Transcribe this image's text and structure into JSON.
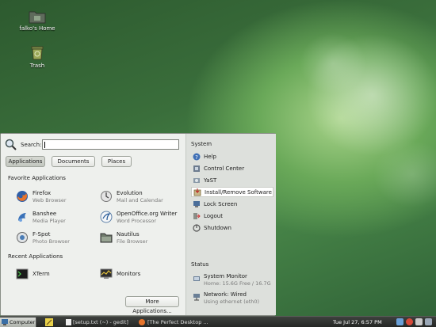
{
  "desktop": {
    "home_label": "falko's Home",
    "trash_label": "Trash"
  },
  "menu": {
    "search_label": "Search:",
    "search_value": "",
    "tabs": [
      {
        "label": "Applications",
        "active": true
      },
      {
        "label": "Documents",
        "active": false
      },
      {
        "label": "Places",
        "active": false
      }
    ],
    "favorites_title": "Favorite Applications",
    "favorites": [
      {
        "name": "Firefox",
        "desc": "Web Browser",
        "icon": "firefox-icon"
      },
      {
        "name": "Evolution",
        "desc": "Mail and Calendar",
        "icon": "evolution-icon"
      },
      {
        "name": "Banshee",
        "desc": "Media Player",
        "icon": "banshee-icon"
      },
      {
        "name": "OpenOffice.org Writer",
        "desc": "Word Processor",
        "icon": "writer-icon"
      },
      {
        "name": "F-Spot",
        "desc": "Photo Browser",
        "icon": "fspot-icon"
      },
      {
        "name": "Nautilus",
        "desc": "File Browser",
        "icon": "nautilus-icon"
      }
    ],
    "recent_title": "Recent Applications",
    "recent": [
      {
        "name": "XTerm",
        "icon": "xterm-icon"
      },
      {
        "name": "Monitors",
        "icon": "monitors-icon"
      }
    ],
    "more_label": "More Applications...",
    "system_title": "System",
    "system_items": [
      {
        "label": "Help",
        "icon": "help-icon"
      },
      {
        "label": "Control Center",
        "icon": "control-center-icon"
      },
      {
        "label": "YaST",
        "icon": "yast-icon"
      },
      {
        "label": "Install/Remove Software",
        "icon": "install-software-icon"
      },
      {
        "label": "Lock Screen",
        "icon": "lock-icon"
      },
      {
        "label": "Logout",
        "icon": "logout-icon"
      },
      {
        "label": "Shutdown",
        "icon": "shutdown-icon"
      }
    ],
    "status_title": "Status",
    "status_items": [
      {
        "name": "System Monitor",
        "desc": "Home: 15.6G Free / 16.7G",
        "icon": "system-monitor-icon"
      },
      {
        "name": "Network: Wired",
        "desc": "Using ethernet (eth0)",
        "icon": "network-icon"
      }
    ]
  },
  "taskbar": {
    "computer_label": "Computer",
    "tasks": [
      {
        "label": "[setup.txt (~) - gedit]"
      },
      {
        "label": "[The Perfect Desktop ..."
      }
    ],
    "clock": "Tue Jul 27,  6:57 PM"
  },
  "colors": {
    "accent": "#4a8a48",
    "menu_bg": "#eef0ed",
    "taskbar_bg": "#2e302e"
  }
}
